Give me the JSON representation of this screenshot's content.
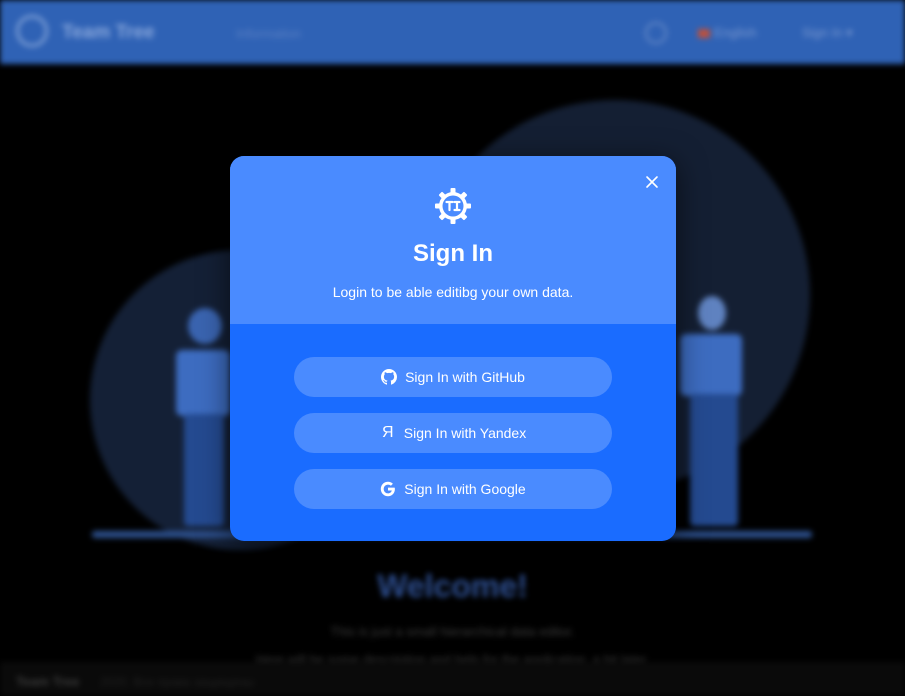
{
  "header": {
    "brand": "Team Tree",
    "nav_label": "Information",
    "language": "English",
    "sign_in": "Sign In",
    "sign_in_chevron": "▾"
  },
  "hero": {
    "title": "Welcome!",
    "line1": "This is just a small hierarchical data editor.",
    "line2": "Here will be some description and help for the application, a bit later."
  },
  "footer": {
    "brand": "Team Tree",
    "text": "2020. Все права защищены"
  },
  "modal": {
    "title": "Sign In",
    "subtitle": "Login to be able editibg your own data.",
    "close_icon": "close-icon",
    "buttons": [
      {
        "label": "Sign In with GitHub",
        "icon": "github-icon"
      },
      {
        "label": "Sign In with Yandex",
        "icon": "yandex-icon",
        "glyph": "Я"
      },
      {
        "label": "Sign In with Google",
        "icon": "google-icon"
      }
    ]
  },
  "colors": {
    "header_bg": "#2f62b5",
    "modal_header": "#4a8bff",
    "modal_body": "#1a6cff",
    "button_bg": "#4a8bff"
  }
}
